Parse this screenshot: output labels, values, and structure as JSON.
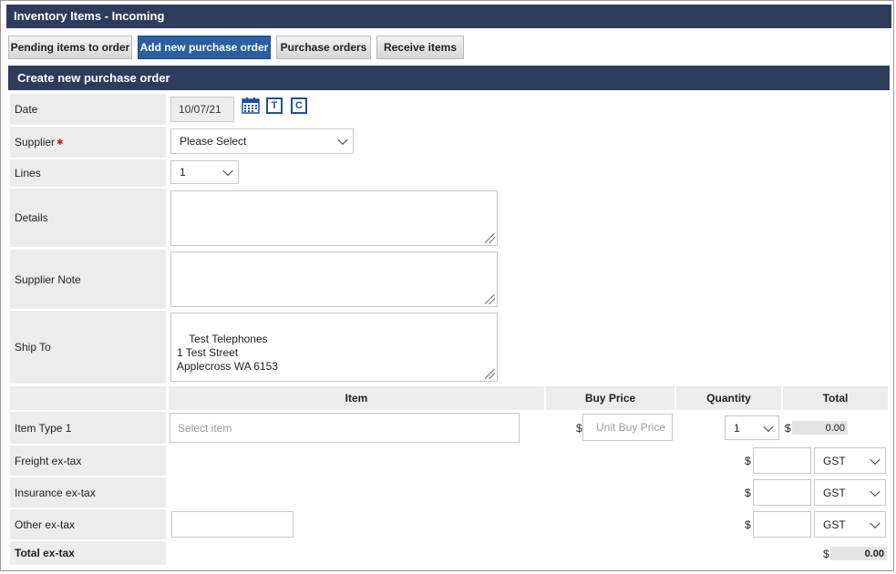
{
  "header": {
    "title": "Inventory Items - Incoming"
  },
  "tabs": [
    {
      "label": "Pending items to order",
      "active": false
    },
    {
      "label": "Add new purchase order",
      "active": true
    },
    {
      "label": "Purchase orders",
      "active": false
    },
    {
      "label": "Receive items",
      "active": false
    }
  ],
  "section": {
    "title": "Create new purchase order"
  },
  "form": {
    "date": {
      "label": "Date",
      "value": "10/07/21",
      "icons": [
        "calendar-icon",
        "today-icon",
        "clear-icon"
      ],
      "today_letter": "T",
      "clear_letter": "C"
    },
    "supplier": {
      "label": "Supplier",
      "required_mark": "✱",
      "value": "Please Select"
    },
    "lines": {
      "label": "Lines",
      "value": "1"
    },
    "details": {
      "label": "Details",
      "value": ""
    },
    "supplier_note": {
      "label": "Supplier Note",
      "value": ""
    },
    "ship_to": {
      "label": "Ship To",
      "value": "Test Telephones\n1 Test Street\nApplecross WA 6153"
    }
  },
  "table": {
    "headers": {
      "item": "Item",
      "buy_price": "Buy Price",
      "quantity": "Quantity",
      "total": "Total"
    },
    "rows": [
      {
        "label": "Item Type 1",
        "item_placeholder": "Select item",
        "currency": "$",
        "price_placeholder": "Unit Buy Price",
        "quantity": "1",
        "total": "0.00"
      }
    ]
  },
  "extras": [
    {
      "label": "Freight ex-tax",
      "currency": "$",
      "value": "",
      "tax": "GST"
    },
    {
      "label": "Insurance ex-tax",
      "currency": "$",
      "value": "",
      "tax": "GST"
    },
    {
      "label": "Other ex-tax",
      "currency": "$",
      "value": "",
      "tax": "GST",
      "description": ""
    }
  ],
  "grand_total": {
    "label": "Total ex-tax",
    "currency": "$",
    "value": "0.00"
  }
}
